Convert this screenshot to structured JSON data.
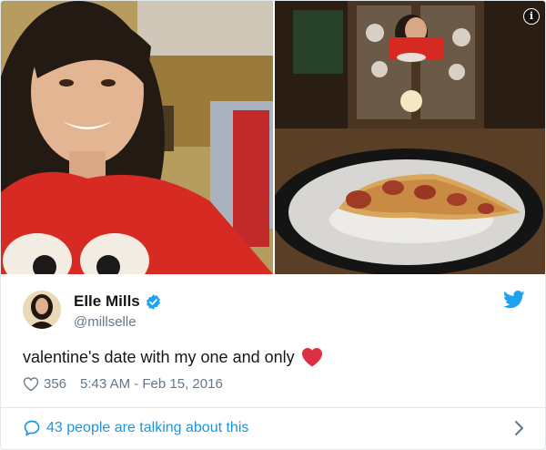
{
  "tweet": {
    "author": {
      "display_name": "Elle Mills",
      "handle": "@millselle",
      "verified": true
    },
    "text": "valentine's date with my one and only",
    "likes": "356",
    "timestamp": "5:43 AM - Feb 15, 2016",
    "talking": "43 people are talking about this"
  },
  "media": {
    "left_photo": "selfie of smiling woman in red t-shirt",
    "right_photo": "slice of pepperoni pizza on a plate at a dining table"
  },
  "colors": {
    "brand_blue": "#1da1f2",
    "link_blue": "#1b95e0",
    "heart_red": "#e0245e",
    "muted_text": "#657786"
  },
  "icons": [
    "info-icon",
    "verified-badge-icon",
    "twitter-bird-icon",
    "heart-emoji-icon",
    "like-heart-icon",
    "reply-bubble-icon",
    "chevron-right-icon"
  ]
}
